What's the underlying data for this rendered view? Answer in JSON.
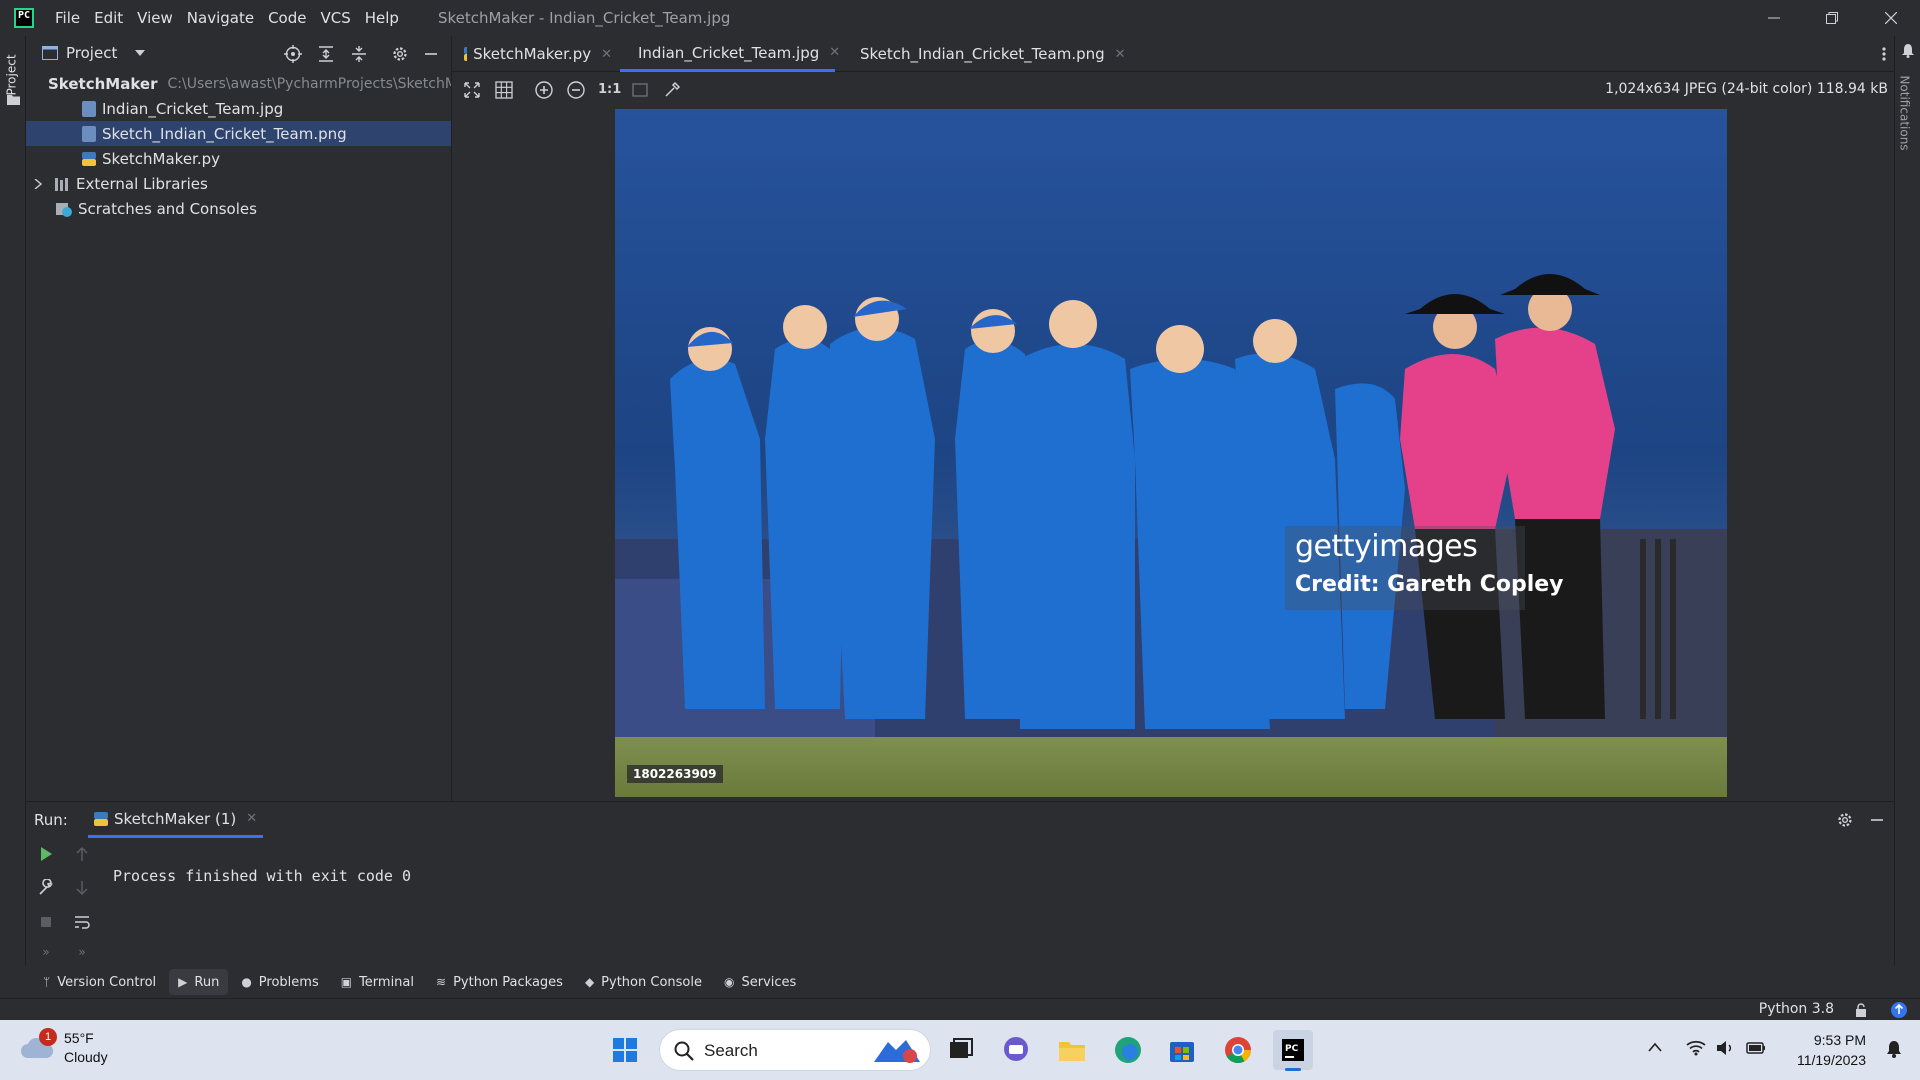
{
  "titlebar": {
    "menu": [
      "File",
      "Edit",
      "View",
      "Navigate",
      "Code",
      "VCS",
      "Help"
    ],
    "window_title": "SketchMaker - Indian_Cricket_Team.jpg"
  },
  "left_stripe": {
    "project_label": "Project"
  },
  "right_stripe": {
    "notifications_label": "Notifications"
  },
  "project": {
    "header": "Project",
    "root_name": "SketchMaker",
    "root_path": "C:\\Users\\awast\\PycharmProjects\\SketchM",
    "files": [
      "Indian_Cricket_Team.jpg",
      "Sketch_Indian_Cricket_Team.png",
      "SketchMaker.py"
    ],
    "external_libraries": "External Libraries",
    "scratches": "Scratches and Consoles"
  },
  "tabs": [
    "SketchMaker.py",
    "Indian_Cricket_Team.jpg",
    "Sketch_Indian_Cricket_Team.png"
  ],
  "image_toolbar": {
    "actual_size": "1:1"
  },
  "image_info": "1,024x634 JPEG (24-bit color) 118.94 kB",
  "photo": {
    "brand": "gettyimages",
    "credit": "Credit: Gareth Copley",
    "image_id": "1802263909"
  },
  "run": {
    "label": "Run:",
    "config": "SketchMaker (1)",
    "output": "Process finished with exit code 0"
  },
  "tool_tabs": [
    "Version Control",
    "Run",
    "Problems",
    "Terminal",
    "Python Packages",
    "Python Console",
    "Services"
  ],
  "status": {
    "interpreter": "Python 3.8"
  },
  "taskbar": {
    "weather_temp": "55°F",
    "weather_cond": "Cloudy",
    "weather_badge": "1",
    "search_placeholder": "Search",
    "time": "9:53 PM",
    "date": "11/19/2023"
  },
  "colors": {
    "accent": "#3574f0",
    "selection": "#2e436e",
    "ide_bg": "#2b2d30",
    "jersey_blue": "#1f6fd1",
    "umpire_pink": "#e5418a"
  }
}
